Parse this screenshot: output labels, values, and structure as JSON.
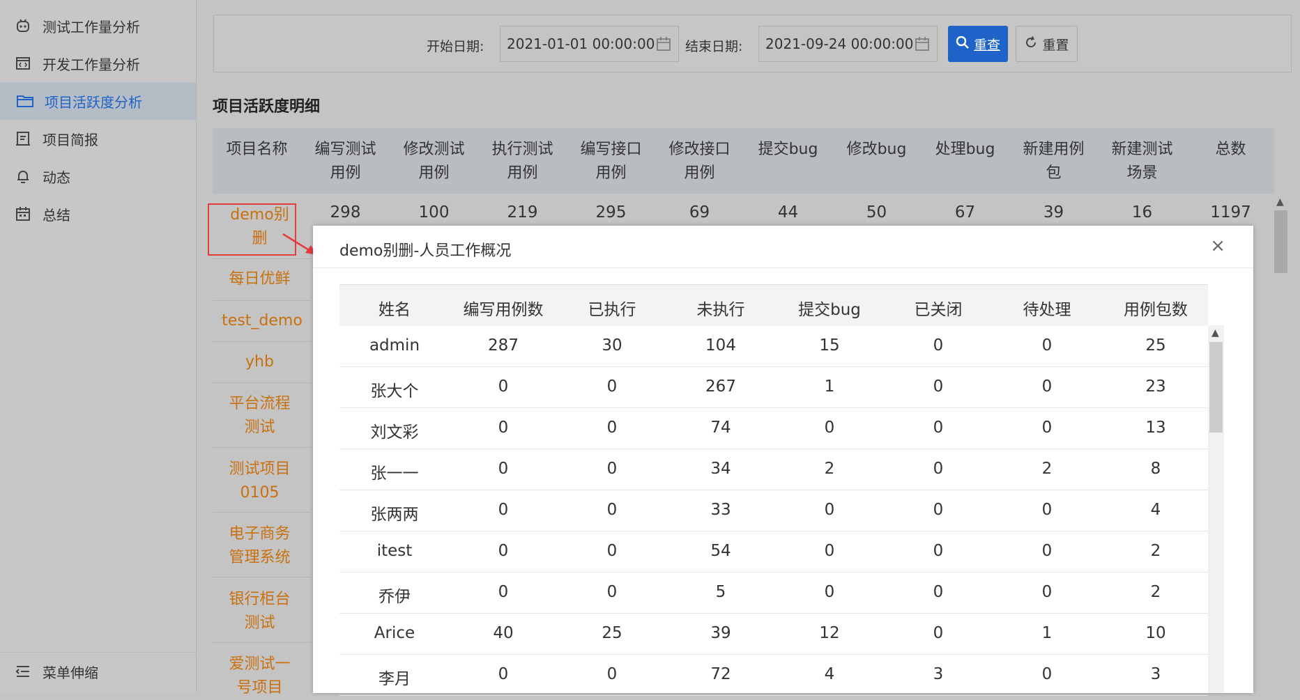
{
  "sidebar": {
    "items": [
      {
        "label": "测试工作量分析",
        "icon": "robot-icon"
      },
      {
        "label": "开发工作量分析",
        "icon": "code-window-icon"
      },
      {
        "label": "项目活跃度分析",
        "icon": "folder-icon",
        "active": true
      },
      {
        "label": "项目简报",
        "icon": "report-icon"
      },
      {
        "label": "动态",
        "icon": "bell-icon"
      },
      {
        "label": "总结",
        "icon": "calendar-icon"
      }
    ],
    "collapse_label": "菜单伸缩"
  },
  "filter": {
    "start_label": "开始日期:",
    "start_value": "2021-01-01 00:00:00",
    "end_label": "结束日期:",
    "end_value": "2021-09-24 00:00:00",
    "search_label": "重查",
    "reset_label": "重置"
  },
  "section_title": "项目活跃度明细",
  "project_table": {
    "headers": [
      [
        "项目名称",
        ""
      ],
      [
        "编写测试",
        "用例"
      ],
      [
        "修改测试",
        "用例"
      ],
      [
        "执行测试",
        "用例"
      ],
      [
        "编写接口",
        "用例"
      ],
      [
        "修改接口",
        "用例"
      ],
      [
        "提交bug",
        ""
      ],
      [
        "修改bug",
        ""
      ],
      [
        "处理bug",
        ""
      ],
      [
        "新建用例",
        "包"
      ],
      [
        "新建测试",
        "场景"
      ],
      [
        "总数",
        ""
      ]
    ],
    "first_row_values": [
      "298",
      "100",
      "219",
      "295",
      "69",
      "44",
      "50",
      "67",
      "39",
      "16",
      "1197"
    ],
    "project_names": [
      [
        "demo别",
        "删"
      ],
      [
        "每日优鲜"
      ],
      [
        "test_demo"
      ],
      [
        "yhb"
      ],
      [
        "平台流程",
        "测试"
      ],
      [
        "测试项目",
        "0105"
      ],
      [
        "电子商务",
        "管理系统"
      ],
      [
        "银行柜台",
        "测试"
      ],
      [
        "爱测试一",
        "号项目"
      ]
    ]
  },
  "modal": {
    "title": "demo别删-人员工作概况",
    "close_glyph": "×",
    "headers": [
      "姓名",
      "编写用例数",
      "已执行",
      "未执行",
      "提交bug",
      "已关闭",
      "待处理",
      "用例包数"
    ],
    "rows": [
      [
        "admin",
        "287",
        "30",
        "104",
        "15",
        "0",
        "0",
        "25"
      ],
      [
        "张大个",
        "0",
        "0",
        "267",
        "1",
        "0",
        "0",
        "23"
      ],
      [
        "刘文彩",
        "0",
        "0",
        "74",
        "0",
        "0",
        "0",
        "13"
      ],
      [
        "张一一",
        "0",
        "0",
        "34",
        "2",
        "0",
        "2",
        "8"
      ],
      [
        "张两两",
        "0",
        "0",
        "33",
        "0",
        "0",
        "0",
        "4"
      ],
      [
        "itest",
        "0",
        "0",
        "54",
        "0",
        "0",
        "0",
        "2"
      ],
      [
        "乔伊",
        "0",
        "0",
        "5",
        "0",
        "0",
        "0",
        "2"
      ],
      [
        "Arice",
        "40",
        "25",
        "39",
        "12",
        "0",
        "1",
        "10"
      ],
      [
        "李月",
        "0",
        "0",
        "72",
        "4",
        "3",
        "0",
        "3"
      ]
    ]
  },
  "colors": {
    "accent": "#1f63c9",
    "project_link": "#c9700f",
    "highlight": "#e43b3b"
  }
}
